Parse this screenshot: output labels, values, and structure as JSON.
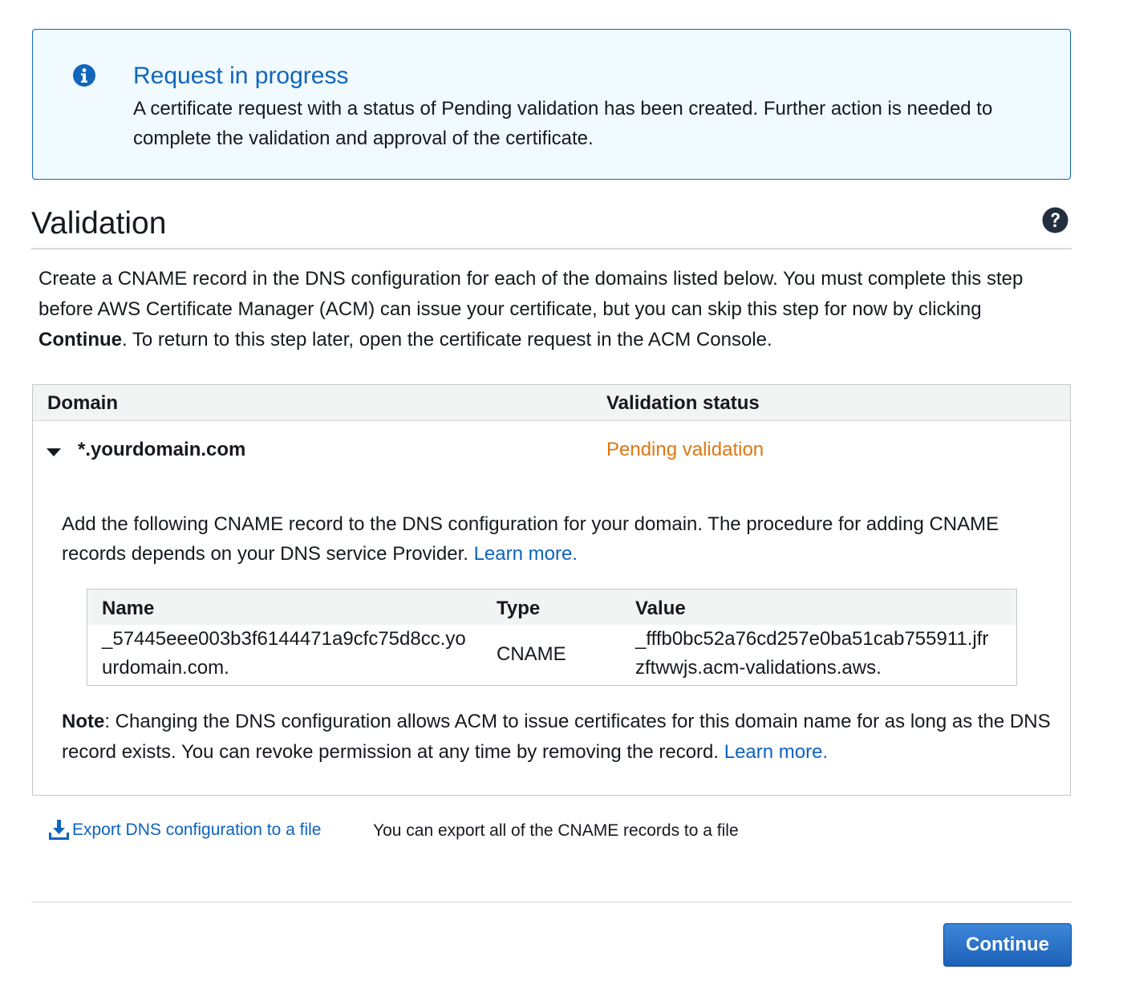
{
  "banner": {
    "icon": "info-icon",
    "title": "Request in progress",
    "text": "A certificate request with a status of Pending validation has been created. Further action is needed to complete the validation and approval of the certificate."
  },
  "section": {
    "title": "Validation",
    "help_icon": "question-icon"
  },
  "intro": {
    "before": "Create a CNAME record in the DNS configuration for each of the domains listed below. You must complete this step before AWS Certificate Manager (ACM) can issue your certificate, but you can skip this step for now by clicking ",
    "bold": "Continue",
    "after": ". To return to this step later, open the certificate request in the ACM Console."
  },
  "domain_table": {
    "headers": {
      "domain": "Domain",
      "status": "Validation status"
    },
    "row": {
      "domain": "*.yourdomain.com",
      "status": "Pending validation",
      "status_color": "#dd7711",
      "expanded_icon": "caret-down-icon"
    },
    "detail": {
      "text": "Add the following CNAME record to the DNS configuration for your domain. The procedure for adding CNAME records depends on your DNS service Provider. ",
      "link": "Learn more."
    },
    "cname": {
      "headers": {
        "name": "Name",
        "type": "Type",
        "value": "Value"
      },
      "name_line1": "_57445eee003b3f6144471a9cfc75d8cc.yo",
      "name_line2": "urdomain.com.",
      "type": "CNAME",
      "value_line1": "_fffb0bc52a76cd257e0ba51cab755911.jfr",
      "value_line2": "zftwwjs.acm-validations.aws."
    },
    "note": {
      "bold": "Note",
      "text": ": Changing the DNS configuration allows ACM to issue certificates for this domain name for as long as the DNS record exists. You can revoke permission at any time by removing the record. ",
      "link": "Learn more."
    }
  },
  "export": {
    "icon": "download-icon",
    "label": "Export DNS configuration to a file",
    "hint": "You can export all of the CNAME records to a file"
  },
  "footer": {
    "continue_label": "Continue"
  },
  "colors": {
    "accent": "#1166bb",
    "link": "#0d63c0",
    "pending": "#dd7711",
    "banner_bg": "#f1faff"
  }
}
